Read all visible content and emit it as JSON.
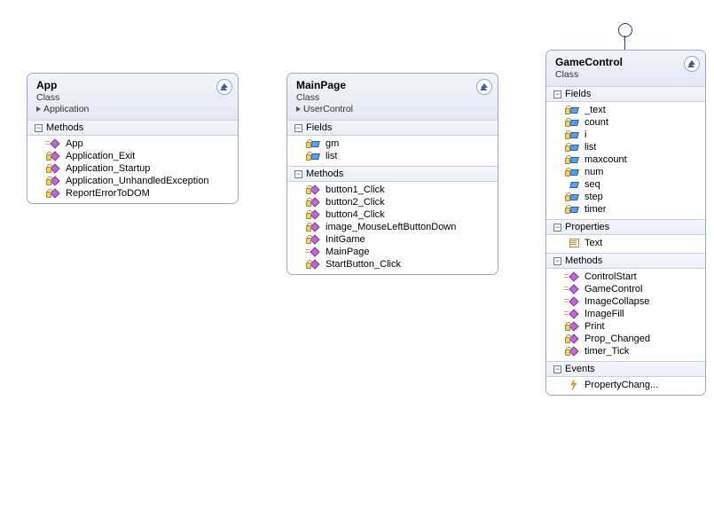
{
  "classes": {
    "app": {
      "name": "App",
      "stereotype": "Class",
      "inherits": "Application",
      "sections": [
        {
          "title": "Methods",
          "members": [
            {
              "icon": "method",
              "name": "App"
            },
            {
              "icon": "method-priv",
              "name": "Application_Exit"
            },
            {
              "icon": "method-priv",
              "name": "Application_Startup"
            },
            {
              "icon": "method-priv",
              "name": "Application_UnhandledException"
            },
            {
              "icon": "method-priv",
              "name": "ReportErrorToDOM"
            }
          ]
        }
      ]
    },
    "mainpage": {
      "name": "MainPage",
      "stereotype": "Class",
      "inherits": "UserControl",
      "sections": [
        {
          "title": "Fields",
          "members": [
            {
              "icon": "field-priv",
              "name": "gm"
            },
            {
              "icon": "field-priv",
              "name": "list"
            }
          ]
        },
        {
          "title": "Methods",
          "members": [
            {
              "icon": "method-priv",
              "name": "button1_Click"
            },
            {
              "icon": "method-priv",
              "name": "button2_Click"
            },
            {
              "icon": "method-priv",
              "name": "button4_Click"
            },
            {
              "icon": "method-priv",
              "name": "image_MouseLeftButtonDown"
            },
            {
              "icon": "method-priv",
              "name": "InitGame"
            },
            {
              "icon": "method",
              "name": "MainPage"
            },
            {
              "icon": "method-priv",
              "name": "StartButton_Click"
            }
          ]
        }
      ]
    },
    "gamecontrol": {
      "name": "GameControl",
      "stereotype": "Class",
      "inherits": null,
      "sections": [
        {
          "title": "Fields",
          "members": [
            {
              "icon": "field-priv",
              "name": "_text"
            },
            {
              "icon": "field-priv",
              "name": "count"
            },
            {
              "icon": "field-priv",
              "name": "i"
            },
            {
              "icon": "field-priv",
              "name": "list"
            },
            {
              "icon": "field-priv",
              "name": "maxcount"
            },
            {
              "icon": "field-priv",
              "name": "num"
            },
            {
              "icon": "field",
              "name": "seq"
            },
            {
              "icon": "field-priv",
              "name": "step"
            },
            {
              "icon": "field-priv",
              "name": "timer"
            }
          ]
        },
        {
          "title": "Properties",
          "members": [
            {
              "icon": "prop",
              "name": "Text"
            }
          ]
        },
        {
          "title": "Methods",
          "members": [
            {
              "icon": "method",
              "name": "ControlStart"
            },
            {
              "icon": "method",
              "name": "GameControl"
            },
            {
              "icon": "method",
              "name": "ImageCollapse"
            },
            {
              "icon": "method",
              "name": "ImageFill"
            },
            {
              "icon": "method-priv",
              "name": "Print"
            },
            {
              "icon": "method-priv",
              "name": "Prop_Changed"
            },
            {
              "icon": "method-priv",
              "name": "timer_Tick"
            }
          ]
        },
        {
          "title": "Events",
          "members": [
            {
              "icon": "event",
              "name": "PropertyChang..."
            }
          ]
        }
      ]
    }
  },
  "chart_data": {
    "type": "table",
    "description": "UML-style class diagram with three classes",
    "classes": [
      {
        "name": "App",
        "inherits": "Application",
        "methods": [
          "App",
          "Application_Exit",
          "Application_Startup",
          "Application_UnhandledException",
          "ReportErrorToDOM"
        ]
      },
      {
        "name": "MainPage",
        "inherits": "UserControl",
        "fields": [
          "gm",
          "list"
        ],
        "methods": [
          "button1_Click",
          "button2_Click",
          "button4_Click",
          "image_MouseLeftButtonDown",
          "InitGame",
          "MainPage",
          "StartButton_Click"
        ]
      },
      {
        "name": "GameControl",
        "inherits": null,
        "fields": [
          "_text",
          "count",
          "i",
          "list",
          "maxcount",
          "num",
          "seq",
          "step",
          "timer"
        ],
        "properties": [
          "Text"
        ],
        "methods": [
          "ControlStart",
          "GameControl",
          "ImageCollapse",
          "ImageFill",
          "Print",
          "Prop_Changed",
          "timer_Tick"
        ],
        "events": [
          "PropertyChanged"
        ]
      }
    ]
  }
}
